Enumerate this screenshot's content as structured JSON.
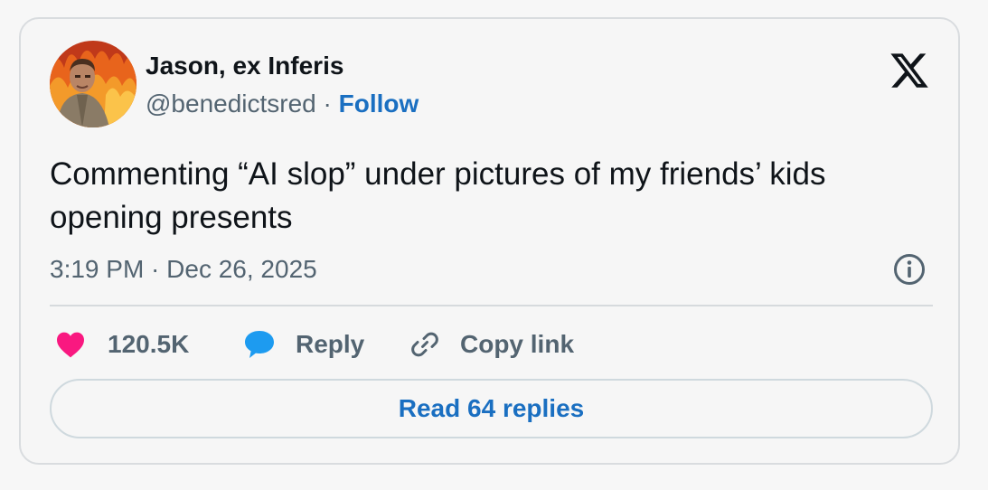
{
  "author": {
    "display_name": "Jason, ex Inferis",
    "handle": "@benedictsred",
    "separator": " · ",
    "follow_label": "Follow"
  },
  "tweet": {
    "text": "Commenting “AI slop” under pictures of my friends’ kids opening presents",
    "timestamp": "3:19 PM · Dec 26, 2025"
  },
  "actions": {
    "like_count": "120.5K",
    "reply_label": "Reply",
    "copy_link_label": "Copy link"
  },
  "read_replies_label": "Read 64 replies",
  "icons": {
    "brand": "x-logo-icon",
    "info": "info-icon",
    "like": "heart-icon",
    "reply": "speech-bubble-icon",
    "copy": "link-icon"
  },
  "colors": {
    "link_blue": "#1a6fc1",
    "heart_pink": "#f91880",
    "reply_blue": "#1d9bf0",
    "muted_text": "#536471",
    "border": "#d9dcdf"
  }
}
